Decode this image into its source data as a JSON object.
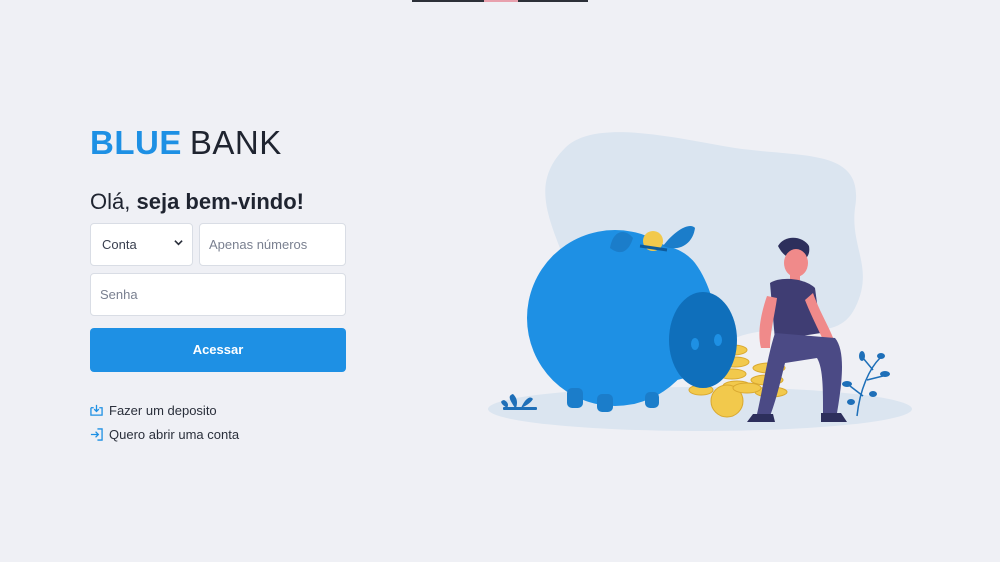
{
  "brand": {
    "name_part1": "BLUE",
    "name_part2": "BANK"
  },
  "greeting": {
    "prefix": "Olá,",
    "emphasis": "seja bem-vindo!"
  },
  "form": {
    "account_type": {
      "selected": "Conta"
    },
    "account_number": {
      "placeholder": "Apenas números"
    },
    "password": {
      "placeholder": "Senha"
    },
    "submit_label": "Acessar"
  },
  "links": {
    "deposit": {
      "label": "Fazer um deposito",
      "icon": "download-tray-icon"
    },
    "open_account": {
      "label": "Quero abrir uma conta",
      "icon": "sign-in-arrow-icon"
    }
  },
  "colors": {
    "accent": "#1e90e4",
    "background": "#eff0f5"
  }
}
